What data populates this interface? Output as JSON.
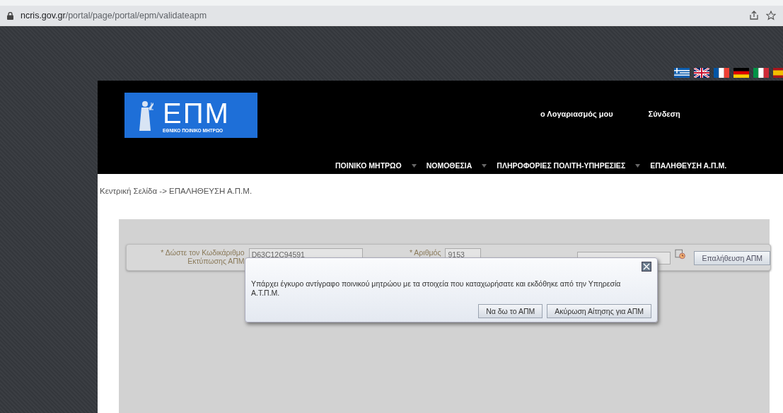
{
  "browser": {
    "url_host": "ncris.gov.gr",
    "url_path": "/portal/page/portal/epm/validateapm"
  },
  "header": {
    "logo_text": "ΕΠΜ",
    "logo_subtitle": "ΕΘΝΙΚΟ ΠΟΙΝΙΚΟ ΜΗΤΡΩΟ",
    "account_links": [
      "ο Λογαριασμός μου",
      "Σύνδεση"
    ],
    "nav": [
      {
        "label": "ΠΟΙΝΙΚΟ ΜΗΤΡΩΟ",
        "has_menu": true
      },
      {
        "label": "ΝΟΜΟΘΕΣΙΑ",
        "has_menu": true
      },
      {
        "label": "ΠΛΗΡΟΦΟΡΙΕΣ ΠΟΛΙΤΗ-ΥΠΗΡΕΣΙΕΣ",
        "has_menu": true
      },
      {
        "label": "ΕΠΑΛΗΘΕΥΣΗ Α.Π.Μ.",
        "has_menu": false
      }
    ]
  },
  "breadcrumb": "Κεντρική Σελίδα -> ΕΠΑΛΗΘΕΥΣΗ Α.Π.Μ.",
  "form": {
    "code_label": "* Δώστε τον Κωδικάριθμο Εκτύπωσης ΑΠΜ",
    "code_value": "D63C12C94591",
    "number_label": "* Αριθμός",
    "number_value": "9153",
    "verify_button": "Επαλήθευση ΑΠΜ"
  },
  "dialog": {
    "message": "Υπάρχει έγκυρο αντίγραφο ποινικού μητρώου με τα στοιχεία που καταχωρήσατε και εκδόθηκε από την Υπηρεσία Α.Τ.Π.Μ.",
    "buttons": [
      "Να δω το ΑΠΜ",
      "Ακύρωση Αίτησης για ΑΠΜ"
    ]
  }
}
